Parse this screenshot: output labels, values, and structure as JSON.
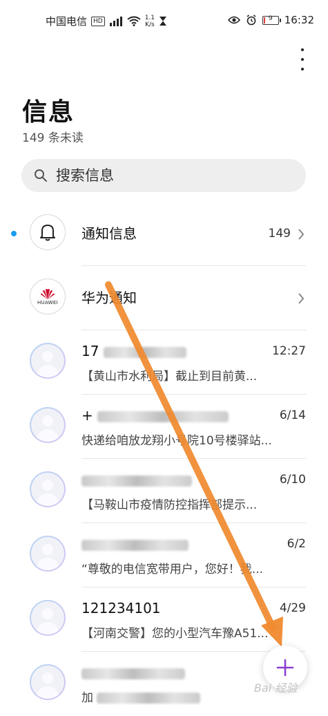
{
  "status_bar": {
    "carrier": "中国电信",
    "hd": "HD",
    "net_speed_value": "1.1",
    "net_speed_unit": "K/s",
    "battery": "9",
    "battery_level": 0.09,
    "time": "16:32"
  },
  "header": {
    "title": "信息",
    "unread": "149 条未读"
  },
  "search": {
    "placeholder": "搜索信息"
  },
  "conversations": [
    {
      "title": "通知信息",
      "meta": "149",
      "preview": "",
      "avatar": "bell-icon",
      "unread": true
    },
    {
      "title": "华为通知",
      "meta": "",
      "preview": "",
      "avatar": "huawei-logo",
      "logo_text": "HUAWEI"
    },
    {
      "title": "17",
      "meta": "12:27",
      "preview": "【黄山市水利局】截止到目前黄..."
    },
    {
      "title": "+",
      "meta": "6/14",
      "preview": "快递给咱放龙翔小号院10号楼驿站..."
    },
    {
      "title": "",
      "meta": "6/10",
      "preview": "【马鞍山市疫情防控指挥部提示..."
    },
    {
      "title": "",
      "meta": "6/2",
      "preview": "“尊敬的电信宽带用户，您好！我..."
    },
    {
      "title": "121234101",
      "meta": "4/29",
      "preview": "【河南交警】您的小型汽车豫A51..."
    },
    {
      "title": "",
      "meta": "",
      "preview": "加"
    }
  ],
  "fab": {
    "icon": "plus-icon"
  },
  "watermark": "Bai 经验",
  "colors": {
    "accent": "#1a9df0",
    "fab_plus": "#8a3fd1",
    "annotation_arrow": "#f08a2e",
    "battery_low": "#e23b3b"
  }
}
